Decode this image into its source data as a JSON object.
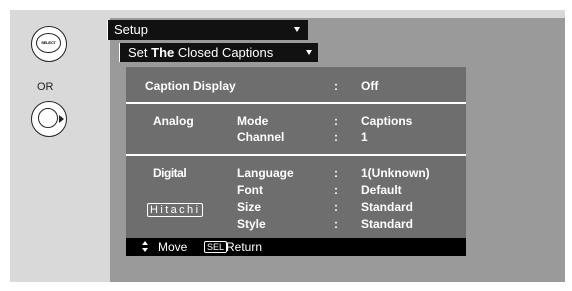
{
  "remote": {
    "select_label": "SELECT",
    "or_label": "OR"
  },
  "menu": {
    "setup_label": "Setup",
    "submenu_prefix": "Set ",
    "submenu_bold": "The",
    "submenu_suffix": " Closed Captions"
  },
  "caption_display": {
    "label": "Caption Display",
    "sep": ":",
    "value": "Off"
  },
  "analog": {
    "section_label": "Analog",
    "rows": [
      {
        "label": "Mode",
        "sep": ":",
        "value": "Captions"
      },
      {
        "label": "Channel",
        "sep": ":",
        "value": "1"
      }
    ]
  },
  "digital": {
    "section_label": "Digital",
    "brand": "Hitachi",
    "rows": [
      {
        "label": "Language",
        "sep": ":",
        "value": "1(Unknown)"
      },
      {
        "label": "Font",
        "sep": ":",
        "value": "Default"
      },
      {
        "label": "Size",
        "sep": ":",
        "value": "Standard"
      },
      {
        "label": "Style",
        "sep": ":",
        "value": "Standard"
      }
    ]
  },
  "footer": {
    "move_label": "Move",
    "sel_label": "SEL",
    "return_label": "Return"
  },
  "colors": {
    "menu_bg": "#111111",
    "panel_bg": "#6e6e6e",
    "screen_bg": "#9a9a9a",
    "frame_bg": "#d9d9d9"
  }
}
